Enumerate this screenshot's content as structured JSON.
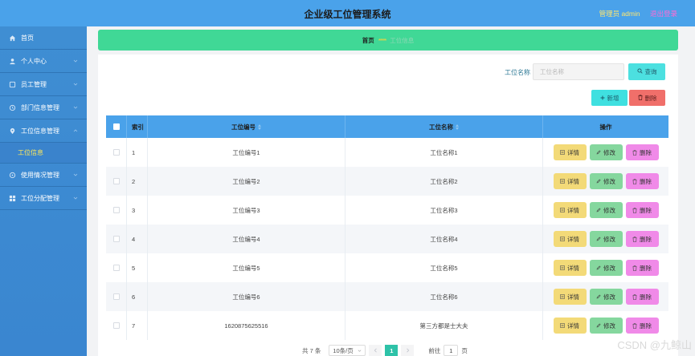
{
  "header": {
    "title": "企业级工位管理系统",
    "admin_label": "管理员 admin",
    "logout_label": "退出登录"
  },
  "sidebar": {
    "items": [
      {
        "label": "首页",
        "icon": "home-icon",
        "has_arrow": false
      },
      {
        "label": "个人中心",
        "icon": "user-icon",
        "has_arrow": true
      },
      {
        "label": "员工管理",
        "icon": "staff-icon",
        "has_arrow": true
      },
      {
        "label": "部门信息管理",
        "icon": "department-icon",
        "has_arrow": true
      },
      {
        "label": "工位信息管理",
        "icon": "location-pin-icon",
        "has_arrow": true
      },
      {
        "label": "使用情况管理",
        "icon": "usage-icon",
        "has_arrow": true
      },
      {
        "label": "工位分配管理",
        "icon": "grid-icon",
        "has_arrow": true
      }
    ],
    "active_submenu": "工位信息"
  },
  "breadcrumb": {
    "home": "首页",
    "separator": "*****",
    "current": "工位信息"
  },
  "search": {
    "label": "工位名称",
    "placeholder": "工位名称",
    "button_label": "查询"
  },
  "toolbar": {
    "add_label": "新增",
    "delete_label": "删除"
  },
  "table": {
    "headers": {
      "index": "索引",
      "code": "工位编号",
      "name": "工位名称",
      "ops": "操作"
    },
    "ops_labels": {
      "detail": "详情",
      "edit": "修改",
      "delete": "删除"
    },
    "rows": [
      {
        "index": "1",
        "code": "工位编号1",
        "name": "工位名称1"
      },
      {
        "index": "2",
        "code": "工位编号2",
        "name": "工位名称2"
      },
      {
        "index": "3",
        "code": "工位编号3",
        "name": "工位名称3"
      },
      {
        "index": "4",
        "code": "工位编号4",
        "name": "工位名称4"
      },
      {
        "index": "5",
        "code": "工位编号5",
        "name": "工位名称5"
      },
      {
        "index": "6",
        "code": "工位编号6",
        "name": "工位名称6"
      },
      {
        "index": "7",
        "code": "1620875625516",
        "name": "第三方都是士大夫"
      }
    ]
  },
  "pagination": {
    "total_text": "共 7 条",
    "page_size": "10条/页",
    "current_page": "1",
    "goto_label": "前往",
    "goto_value": "1",
    "page_unit": "页"
  },
  "watermark": "CSDN @九鲸山",
  "colors": {
    "topbar": "#4aa2ea",
    "sidebar": "#3f8ed3",
    "breadcrumb_bg": "#40d896",
    "table_header": "#4aa2ea",
    "detail_button": "#f3da78",
    "edit_button": "#85d79e",
    "delete_row_button": "#f08ae8",
    "delete_button": "#f06f6a",
    "add_button": "#3fe0e0",
    "admin_text": "#ffe66e",
    "logout_text": "#ff6ad5"
  }
}
